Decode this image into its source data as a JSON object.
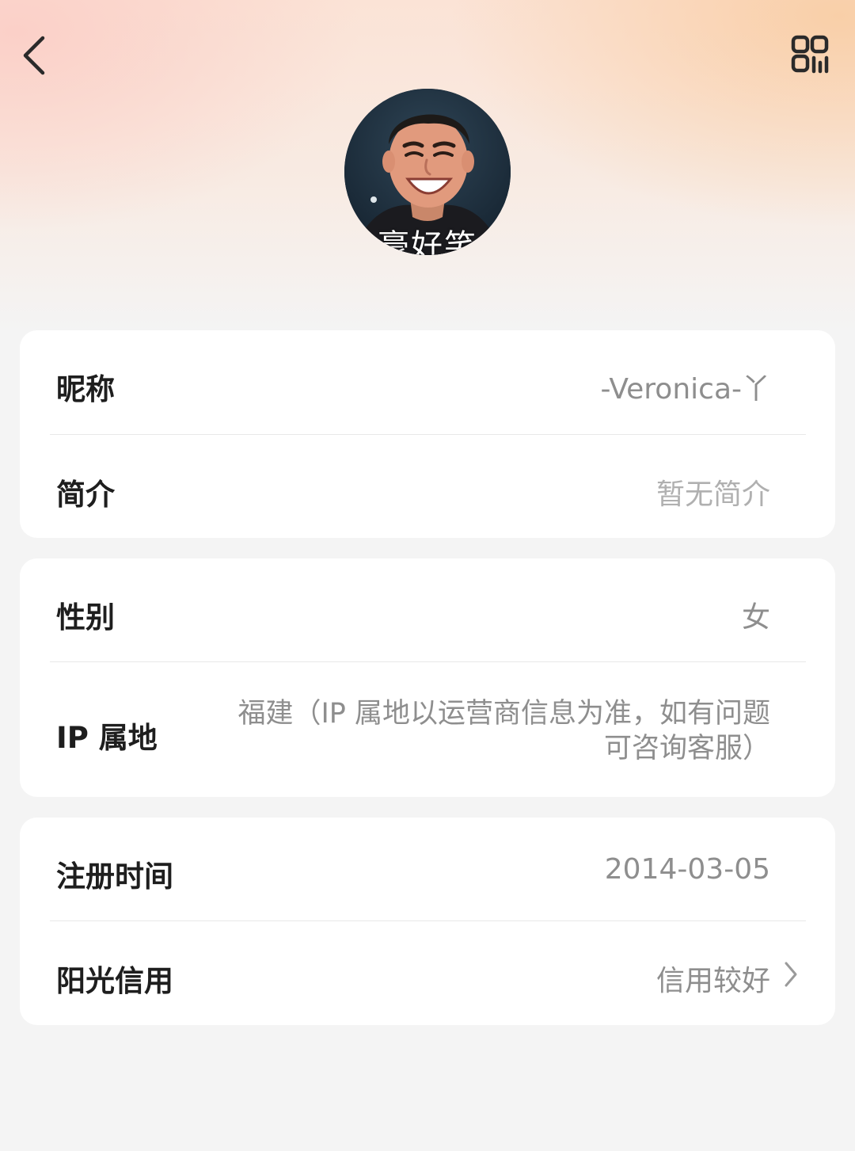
{
  "header": {
    "back_icon": "chevron-left-icon",
    "qr_icon": "qr-code-icon",
    "avatar_caption": "豪好笑"
  },
  "card_basic": {
    "nickname_label": "昵称",
    "nickname_value": "-Veronica-丫",
    "bio_label": "简介",
    "bio_value": "暂无简介"
  },
  "card_info": {
    "gender_label": "性别",
    "gender_value": "女",
    "ip_label": "IP 属地",
    "ip_value_line1": "福建（IP 属地以运营商信息为准，如有问题",
    "ip_value_line2": "可咨询客服）"
  },
  "card_account": {
    "register_label": "注册时间",
    "register_value": "2014-03-05",
    "credit_label": "阳光信用",
    "credit_value": "信用较好",
    "credit_icon": "chevron-right-icon"
  }
}
